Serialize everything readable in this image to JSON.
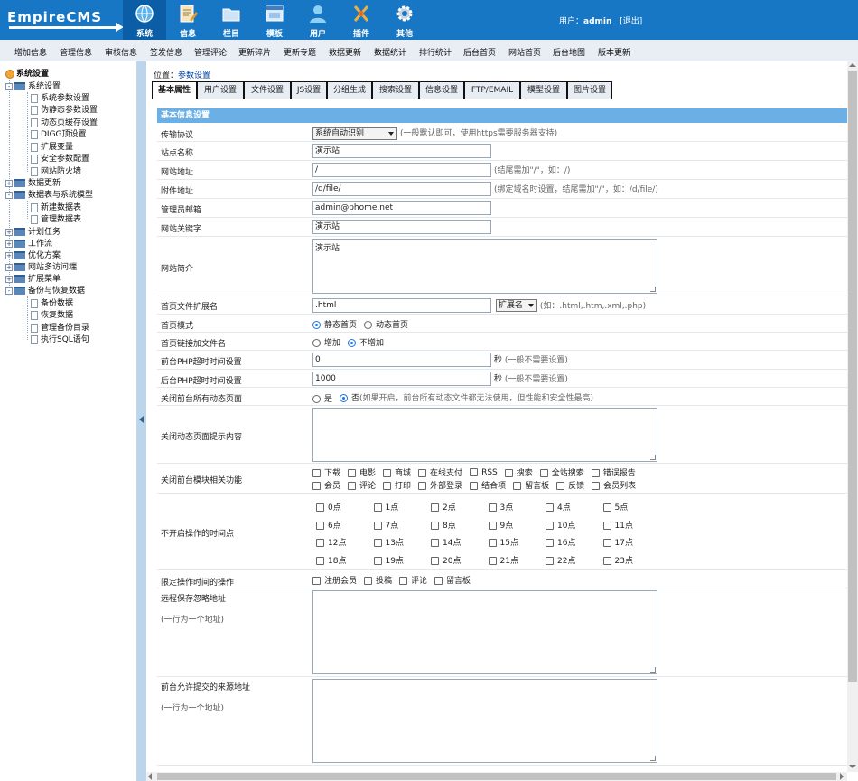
{
  "app": {
    "logo_text": "EmpireCMS"
  },
  "top_nav": [
    {
      "label": "系统",
      "icon": "globe-icon",
      "active": true
    },
    {
      "label": "信息",
      "icon": "document-edit-icon"
    },
    {
      "label": "栏目",
      "icon": "folder-icon"
    },
    {
      "label": "模板",
      "icon": "template-window-icon"
    },
    {
      "label": "用户",
      "icon": "user-icon"
    },
    {
      "label": "插件",
      "icon": "tools-icon"
    },
    {
      "label": "其他",
      "icon": "gear-icon"
    }
  ],
  "user": {
    "prefix": "用户：",
    "name": "admin",
    "logout": "[退出]"
  },
  "sub_nav": [
    "增加信息",
    "管理信息",
    "审核信息",
    "签发信息",
    "管理评论",
    "更新碎片",
    "更新专题",
    "数据更新",
    "数据统计",
    "排行统计",
    "后台首页",
    "网站首页",
    "后台地图",
    "版本更新"
  ],
  "tree": {
    "root": "系统设置",
    "groups": [
      {
        "label": "系统设置",
        "expanded": true,
        "children": [
          "系统参数设置",
          "伪静态参数设置",
          "动态页缓存设置",
          "DIGG顶设置",
          "扩展变量",
          "安全参数配置",
          "网站防火墙"
        ]
      },
      {
        "label": "数据更新",
        "expanded": false
      },
      {
        "label": "数据表与系统模型",
        "expanded": true,
        "children": [
          "新建数据表",
          "管理数据表"
        ]
      },
      {
        "label": "计划任务",
        "expanded": false
      },
      {
        "label": "工作流",
        "expanded": false
      },
      {
        "label": "优化方案",
        "expanded": false
      },
      {
        "label": "网站多访问端",
        "expanded": false
      },
      {
        "label": "扩展菜单",
        "expanded": false
      },
      {
        "label": "备份与恢复数据",
        "expanded": true,
        "children": [
          "备份数据",
          "恢复数据",
          "管理备份目录",
          "执行SQL语句"
        ]
      }
    ]
  },
  "breadcrumb": {
    "prefix": "位置：",
    "link": "参数设置"
  },
  "tabs": [
    "基本属性",
    "用户设置",
    "文件设置",
    "JS设置",
    "分组生成",
    "搜索设置",
    "信息设置",
    "FTP/EMAIL",
    "模型设置",
    "图片设置"
  ],
  "form": {
    "section_title": "基本信息设置",
    "protocol": {
      "label": "传输协议",
      "value": "系统自动识别",
      "hint": "(一般默认即可，使用https需要服务器支持)"
    },
    "site_name": {
      "label": "站点名称",
      "value": "演示站"
    },
    "site_url": {
      "label": "网站地址",
      "value": "/",
      "hint": "(结尾需加\"/\"，如：/)"
    },
    "attach_url": {
      "label": "附件地址",
      "value": "/d/file/",
      "hint": "(绑定域名时设置，结尾需加\"/\"，如：/d/file/)"
    },
    "admin_email": {
      "label": "管理员邮箱",
      "value": "admin@phome.net"
    },
    "keywords": {
      "label": "网站关键字",
      "value": "演示站"
    },
    "intro": {
      "label": "网站简介",
      "value": "演示站"
    },
    "index_ext": {
      "label": "首页文件扩展名",
      "value": ".html",
      "select": "扩展名",
      "hint": "(如：.html,.htm,.xml,.php)"
    },
    "index_mode": {
      "label": "首页模式",
      "options": [
        "静态首页",
        "动态首页"
      ],
      "selected": "静态首页"
    },
    "index_link_file": {
      "label": "首页链接加文件名",
      "options": [
        "增加",
        "不增加"
      ],
      "selected": "不增加"
    },
    "front_timeout": {
      "label": "前台PHP超时时间设置",
      "value": "0",
      "unit": "秒",
      "hint": "(一般不需要设置)"
    },
    "back_timeout": {
      "label": "后台PHP超时时间设置",
      "value": "1000",
      "unit": "秒",
      "hint": "(一般不需要设置)"
    },
    "close_dynamic": {
      "label": "关闭前台所有动态页面",
      "options": [
        "是",
        "否"
      ],
      "selected": "否",
      "hint": "(如果开启，前台所有动态文件都无法使用，但性能和安全性最高)"
    },
    "close_msg": {
      "label": "关闭动态页面提示内容",
      "value": ""
    },
    "close_modules": {
      "label": "关闭前台模块相关功能",
      "row1": [
        "下载",
        "电影",
        "商城",
        "在线支付",
        "RSS",
        "搜索",
        "全站搜索",
        "错误报告"
      ],
      "row2": [
        "会员",
        "评论",
        "打印",
        "外部登录",
        "结合项",
        "留言板",
        "反馈",
        "会员列表"
      ]
    },
    "closed_hours": {
      "label": "不开启操作的时间点",
      "hours": [
        "0点",
        "1点",
        "2点",
        "3点",
        "4点",
        "5点",
        "6点",
        "7点",
        "8点",
        "9点",
        "10点",
        "11点",
        "12点",
        "13点",
        "14点",
        "15点",
        "16点",
        "17点",
        "18点",
        "19点",
        "20点",
        "21点",
        "22点",
        "23点"
      ]
    },
    "limit_ops": {
      "label": "限定操作时间的操作",
      "options": [
        "注册会员",
        "投稿",
        "评论",
        "留言板"
      ]
    },
    "remote_ignore": {
      "label": "远程保存忽略地址",
      "sub": "(一行为一个地址)"
    },
    "allowed_source": {
      "label": "前台允许提交的来源地址",
      "sub": "(一行为一个地址)"
    }
  }
}
